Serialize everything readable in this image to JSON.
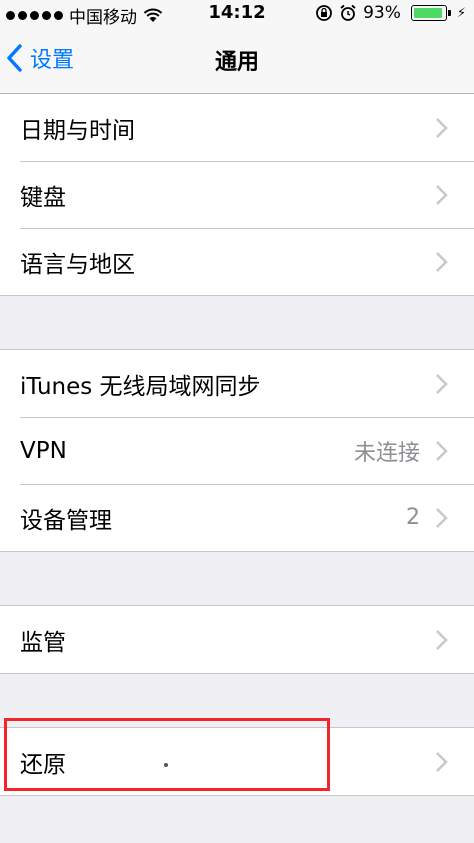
{
  "status_bar": {
    "carrier": "中国移动",
    "time": "14:12",
    "battery_percent": "93%",
    "battery_level": 0.93
  },
  "nav": {
    "back_label": "设置",
    "title": "通用"
  },
  "groups": [
    {
      "rows": [
        {
          "label": "日期与时间",
          "detail": ""
        },
        {
          "label": "键盘",
          "detail": ""
        },
        {
          "label": "语言与地区",
          "detail": ""
        }
      ]
    },
    {
      "rows": [
        {
          "label": "iTunes 无线局域网同步",
          "detail": ""
        },
        {
          "label": "VPN",
          "detail": "未连接"
        },
        {
          "label": "设备管理",
          "detail": "2"
        }
      ]
    },
    {
      "rows": [
        {
          "label": "监管",
          "detail": ""
        }
      ]
    },
    {
      "rows": [
        {
          "label": "还原",
          "detail": ""
        }
      ]
    }
  ],
  "colors": {
    "accent": "#007aff",
    "highlight": "#f0262b",
    "battery": "#4cd964"
  }
}
